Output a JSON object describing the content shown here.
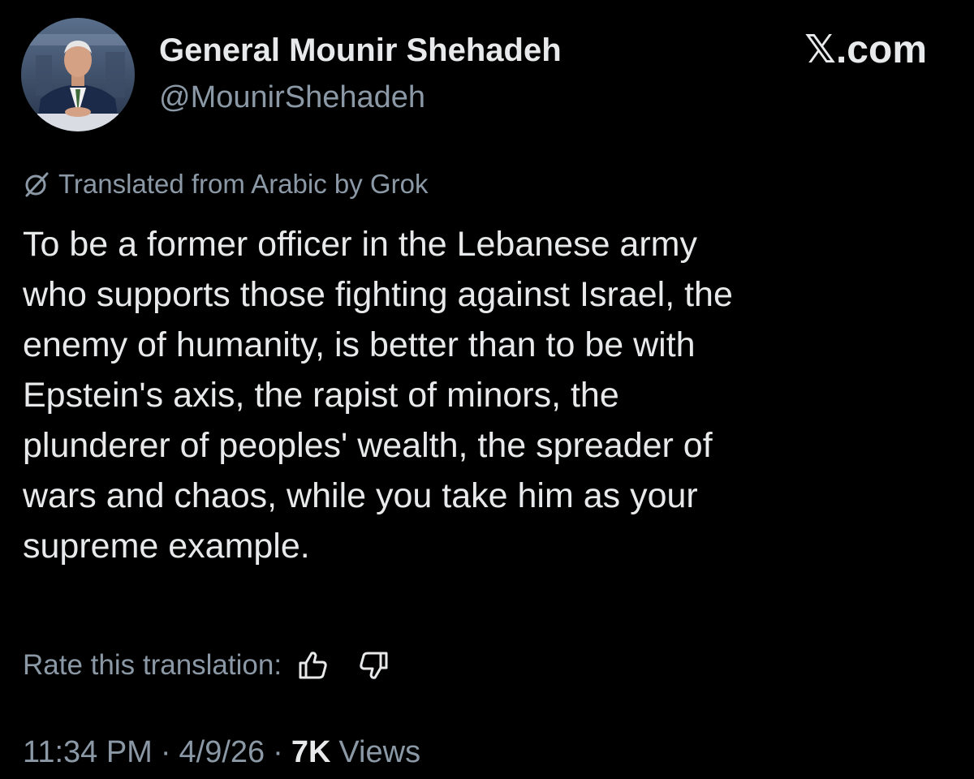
{
  "author": {
    "display_name": "General Mounir Shehadeh",
    "handle": "@MounirShehadeh",
    "avatar_icon": "profile-photo"
  },
  "site_mark": "𝕏.com",
  "translation_notice": {
    "icon": "grok-icon",
    "text": "Translated from Arabic by Grok"
  },
  "tweet": {
    "lines": [
      "To be a former officer in the Lebanese army",
      "who supports those fighting against Israel, the",
      "enemy of humanity, is better than to be with",
      "Epstein's axis, the rapist of minors, the",
      "plunderer of peoples' wealth, the spreader of",
      "wars and chaos, while you take him as your",
      "supreme example."
    ]
  },
  "rating": {
    "label": "Rate this translation:",
    "thumbs_up_icon": "thumbs-up-icon",
    "thumbs_down_icon": "thumbs-down-icon"
  },
  "meta": {
    "time": "11:34 PM",
    "separator": "·",
    "date": "4/9/26",
    "views_count": "7K",
    "views_label": "Views"
  },
  "colors": {
    "background": "#000000",
    "primary_text": "#e7e9ea",
    "secondary_text": "#8b98a5"
  }
}
